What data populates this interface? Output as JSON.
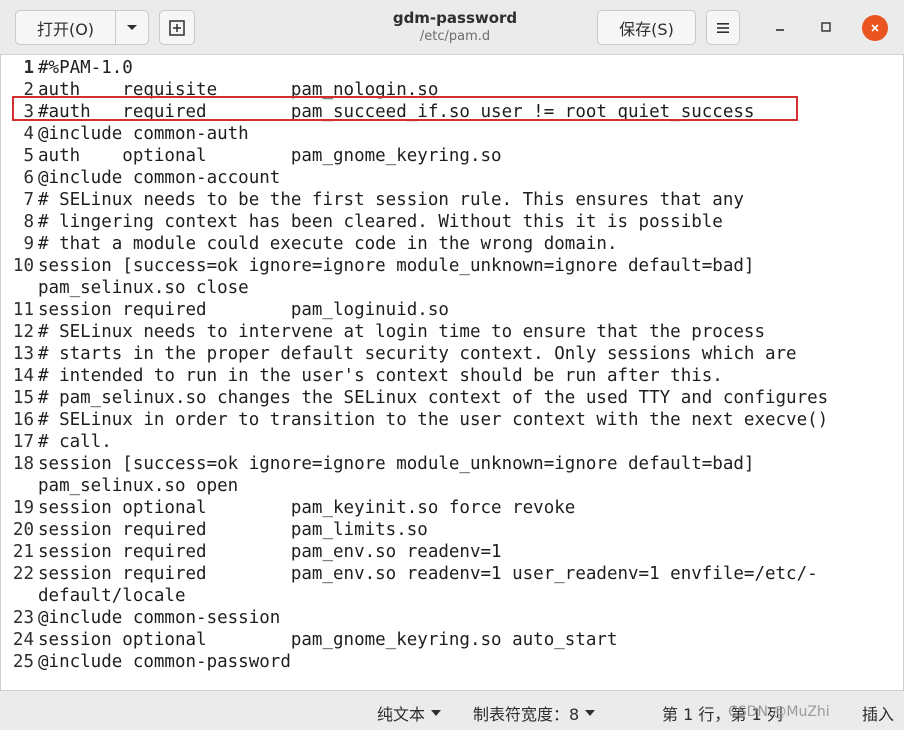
{
  "header": {
    "open_label": "打开(O)",
    "title": "gdm-password",
    "subtitle": "/etc/pam.d",
    "save_label": "保存(S)",
    "icons": {
      "open_menu": "chevron-down-icon",
      "new_tab": "new-document-icon",
      "menu": "hamburger-icon",
      "minimize": "minimize-icon",
      "maximize": "maximize-icon",
      "close": "close-icon"
    },
    "close_color": "#e95420"
  },
  "editor": {
    "lines": [
      {
        "num": "1",
        "text": "#%PAM-1.0"
      },
      {
        "num": "2",
        "text": "auth    requisite       pam_nologin.so"
      },
      {
        "num": "3",
        "text": "#auth   required        pam_succeed_if.so user != root quiet_success"
      },
      {
        "num": "4",
        "text": "@include common-auth"
      },
      {
        "num": "5",
        "text": "auth    optional        pam_gnome_keyring.so"
      },
      {
        "num": "6",
        "text": "@include common-account"
      },
      {
        "num": "7",
        "text": "# SELinux needs to be the first session rule. This ensures that any"
      },
      {
        "num": "8",
        "text": "# lingering context has been cleared. Without this it is possible"
      },
      {
        "num": "9",
        "text": "# that a module could execute code in the wrong domain."
      },
      {
        "num": "10",
        "text": "session [success=ok ignore=ignore module_unknown=ignore default=bad]"
      },
      {
        "num": "",
        "text": "pam_selinux.so close"
      },
      {
        "num": "11",
        "text": "session required        pam_loginuid.so"
      },
      {
        "num": "12",
        "text": "# SELinux needs to intervene at login time to ensure that the process"
      },
      {
        "num": "13",
        "text": "# starts in the proper default security context. Only sessions which are"
      },
      {
        "num": "14",
        "text": "# intended to run in the user's context should be run after this."
      },
      {
        "num": "15",
        "text": "# pam_selinux.so changes the SELinux context of the used TTY and configures"
      },
      {
        "num": "16",
        "text": "# SELinux in order to transition to the user context with the next execve()"
      },
      {
        "num": "17",
        "text": "# call."
      },
      {
        "num": "18",
        "text": "session [success=ok ignore=ignore module_unknown=ignore default=bad]"
      },
      {
        "num": "",
        "text": "pam_selinux.so open"
      },
      {
        "num": "19",
        "text": "session optional        pam_keyinit.so force revoke"
      },
      {
        "num": "20",
        "text": "session required        pam_limits.so"
      },
      {
        "num": "21",
        "text": "session required        pam_env.so readenv=1"
      },
      {
        "num": "22",
        "text": "session required        pam_env.so readenv=1 user_readenv=1 envfile=/etc/-"
      },
      {
        "num": "",
        "text": "default/locale"
      },
      {
        "num": "23",
        "text": "@include common-session"
      },
      {
        "num": "24",
        "text": "session optional        pam_gnome_keyring.so auto_start"
      },
      {
        "num": "25",
        "text": "@include common-password"
      }
    ],
    "highlight_color": "#d32f2f"
  },
  "statusbar": {
    "language": "纯文本",
    "tab_width": "制表符宽度：8",
    "position": "第 1 行，第 1 列",
    "mode": "插入",
    "watermark": "CSDN @MuZhi"
  }
}
